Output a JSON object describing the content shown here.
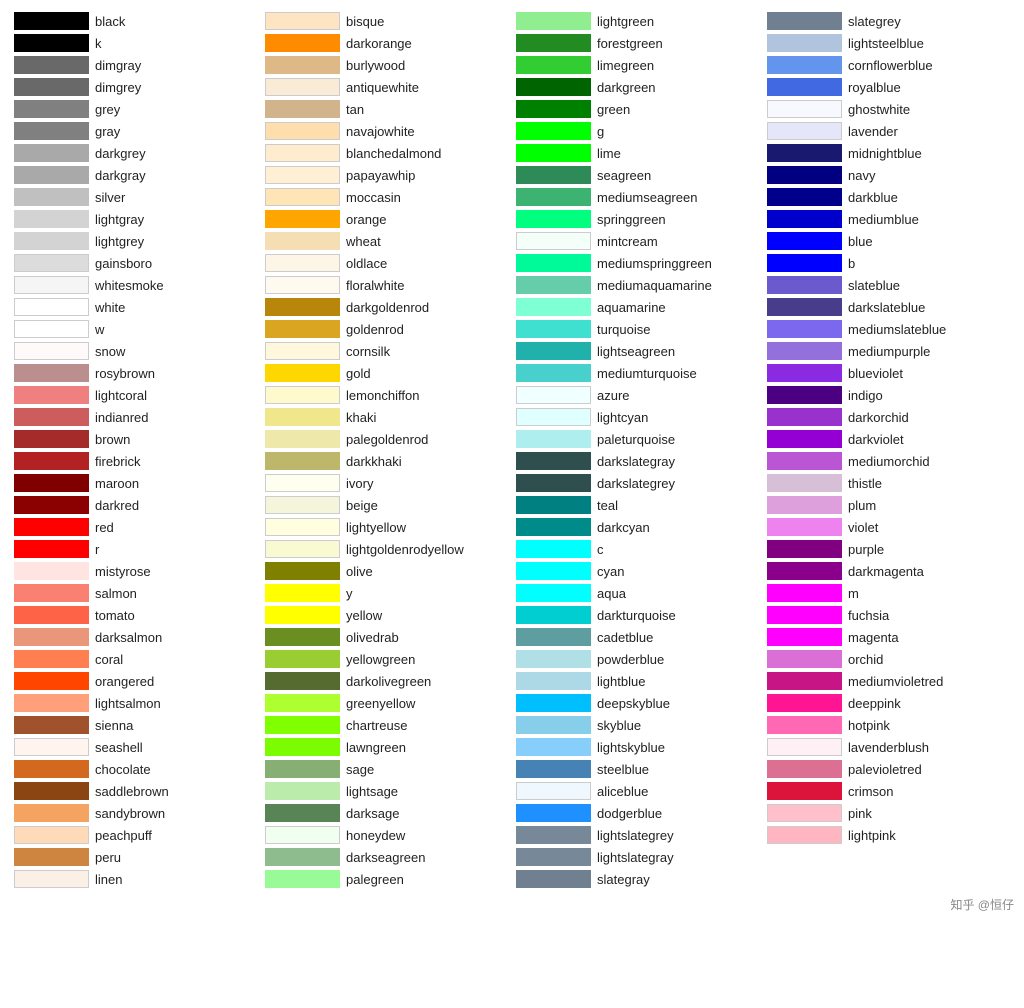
{
  "columns": [
    [
      {
        "name": "black",
        "color": "#000000"
      },
      {
        "name": "k",
        "color": "#000000"
      },
      {
        "name": "dimgray",
        "color": "#696969"
      },
      {
        "name": "dimgrey",
        "color": "#696969"
      },
      {
        "name": "grey",
        "color": "#808080"
      },
      {
        "name": "gray",
        "color": "#808080"
      },
      {
        "name": "darkgrey",
        "color": "#a9a9a9"
      },
      {
        "name": "darkgray",
        "color": "#a9a9a9"
      },
      {
        "name": "silver",
        "color": "#c0c0c0"
      },
      {
        "name": "lightgray",
        "color": "#d3d3d3"
      },
      {
        "name": "lightgrey",
        "color": "#d3d3d3"
      },
      {
        "name": "gainsboro",
        "color": "#dcdcdc"
      },
      {
        "name": "whitesmoke",
        "color": "#f5f5f5"
      },
      {
        "name": "white",
        "color": "#ffffff"
      },
      {
        "name": "w",
        "color": "#ffffff"
      },
      {
        "name": "snow",
        "color": "#fffafa"
      },
      {
        "name": "rosybrown",
        "color": "#bc8f8f"
      },
      {
        "name": "lightcoral",
        "color": "#f08080"
      },
      {
        "name": "indianred",
        "color": "#cd5c5c"
      },
      {
        "name": "brown",
        "color": "#a52a2a"
      },
      {
        "name": "firebrick",
        "color": "#b22222"
      },
      {
        "name": "maroon",
        "color": "#800000"
      },
      {
        "name": "darkred",
        "color": "#8b0000"
      },
      {
        "name": "red",
        "color": "#ff0000"
      },
      {
        "name": "r",
        "color": "#ff0000"
      },
      {
        "name": "mistyrose",
        "color": "#ffe4e1"
      },
      {
        "name": "salmon",
        "color": "#fa8072"
      },
      {
        "name": "tomato",
        "color": "#ff6347"
      },
      {
        "name": "darksalmon",
        "color": "#e9967a"
      },
      {
        "name": "coral",
        "color": "#ff7f50"
      },
      {
        "name": "orangered",
        "color": "#ff4500"
      },
      {
        "name": "lightsalmon",
        "color": "#ffa07a"
      },
      {
        "name": "sienna",
        "color": "#a0522d"
      },
      {
        "name": "seashell",
        "color": "#fff5ee"
      },
      {
        "name": "chocolate",
        "color": "#d2691e"
      },
      {
        "name": "saddlebrown",
        "color": "#8b4513"
      },
      {
        "name": "sandybrown",
        "color": "#f4a460"
      },
      {
        "name": "peachpuff",
        "color": "#ffdab9"
      },
      {
        "name": "peru",
        "color": "#cd853f"
      },
      {
        "name": "linen",
        "color": "#faf0e6"
      }
    ],
    [
      {
        "name": "bisque",
        "color": "#ffe4c4"
      },
      {
        "name": "darkorange",
        "color": "#ff8c00"
      },
      {
        "name": "burlywood",
        "color": "#deb887"
      },
      {
        "name": "antiquewhite",
        "color": "#faebd7"
      },
      {
        "name": "tan",
        "color": "#d2b48c"
      },
      {
        "name": "navajowhite",
        "color": "#ffdead"
      },
      {
        "name": "blanchedalmond",
        "color": "#ffebcd"
      },
      {
        "name": "papayawhip",
        "color": "#ffefd5"
      },
      {
        "name": "moccasin",
        "color": "#ffe4b5"
      },
      {
        "name": "orange",
        "color": "#ffa500"
      },
      {
        "name": "wheat",
        "color": "#f5deb3"
      },
      {
        "name": "oldlace",
        "color": "#fdf5e6"
      },
      {
        "name": "floralwhite",
        "color": "#fffaf0"
      },
      {
        "name": "darkgoldenrod",
        "color": "#b8860b"
      },
      {
        "name": "goldenrod",
        "color": "#daa520"
      },
      {
        "name": "cornsilk",
        "color": "#fff8dc"
      },
      {
        "name": "gold",
        "color": "#ffd700"
      },
      {
        "name": "lemonchiffon",
        "color": "#fffacd"
      },
      {
        "name": "khaki",
        "color": "#f0e68c"
      },
      {
        "name": "palegoldenrod",
        "color": "#eee8aa"
      },
      {
        "name": "darkkhaki",
        "color": "#bdb76b"
      },
      {
        "name": "ivory",
        "color": "#fffff0"
      },
      {
        "name": "beige",
        "color": "#f5f5dc"
      },
      {
        "name": "lightyellow",
        "color": "#ffffe0"
      },
      {
        "name": "lightgoldenrodyellow",
        "color": "#fafad2"
      },
      {
        "name": "olive",
        "color": "#808000"
      },
      {
        "name": "y",
        "color": "#ffff00"
      },
      {
        "name": "yellow",
        "color": "#ffff00"
      },
      {
        "name": "olivedrab",
        "color": "#6b8e23"
      },
      {
        "name": "yellowgreen",
        "color": "#9acd32"
      },
      {
        "name": "darkolivegreen",
        "color": "#556b2f"
      },
      {
        "name": "greenyellow",
        "color": "#adff2f"
      },
      {
        "name": "chartreuse",
        "color": "#7fff00"
      },
      {
        "name": "lawngreen",
        "color": "#7cfc00"
      },
      {
        "name": "sage",
        "color": "#87ae73"
      },
      {
        "name": "lightsage",
        "color": "#bcecac"
      },
      {
        "name": "darksage",
        "color": "#598556"
      },
      {
        "name": "honeydew",
        "color": "#f0fff0"
      },
      {
        "name": "darkseagreen",
        "color": "#8fbc8f"
      },
      {
        "name": "palegreen",
        "color": "#98fb98"
      }
    ],
    [
      {
        "name": "lightgreen",
        "color": "#90ee90"
      },
      {
        "name": "forestgreen",
        "color": "#228b22"
      },
      {
        "name": "limegreen",
        "color": "#32cd32"
      },
      {
        "name": "darkgreen",
        "color": "#006400"
      },
      {
        "name": "green",
        "color": "#008000"
      },
      {
        "name": "g",
        "color": "#00ff00"
      },
      {
        "name": "lime",
        "color": "#00ff00"
      },
      {
        "name": "seagreen",
        "color": "#2e8b57"
      },
      {
        "name": "mediumseagreen",
        "color": "#3cb371"
      },
      {
        "name": "springgreen",
        "color": "#00ff7f"
      },
      {
        "name": "mintcream",
        "color": "#f5fffa"
      },
      {
        "name": "mediumspringgreen",
        "color": "#00fa9a"
      },
      {
        "name": "mediumaquamarine",
        "color": "#66cdaa"
      },
      {
        "name": "aquamarine",
        "color": "#7fffd4"
      },
      {
        "name": "turquoise",
        "color": "#40e0d0"
      },
      {
        "name": "lightseagreen",
        "color": "#20b2aa"
      },
      {
        "name": "mediumturquoise",
        "color": "#48d1cc"
      },
      {
        "name": "azure",
        "color": "#f0ffff"
      },
      {
        "name": "lightcyan",
        "color": "#e0ffff"
      },
      {
        "name": "paleturquoise",
        "color": "#afeeee"
      },
      {
        "name": "darkslategray",
        "color": "#2f4f4f"
      },
      {
        "name": "darkslategrey",
        "color": "#2f4f4f"
      },
      {
        "name": "teal",
        "color": "#008080"
      },
      {
        "name": "darkcyan",
        "color": "#008b8b"
      },
      {
        "name": "c",
        "color": "#00ffff"
      },
      {
        "name": "cyan",
        "color": "#00ffff"
      },
      {
        "name": "aqua",
        "color": "#00ffff"
      },
      {
        "name": "darkturquoise",
        "color": "#00ced1"
      },
      {
        "name": "cadetblue",
        "color": "#5f9ea0"
      },
      {
        "name": "powderblue",
        "color": "#b0e0e6"
      },
      {
        "name": "lightblue",
        "color": "#add8e6"
      },
      {
        "name": "deepskyblue",
        "color": "#00bfff"
      },
      {
        "name": "skyblue",
        "color": "#87ceeb"
      },
      {
        "name": "lightskyblue",
        "color": "#87cefa"
      },
      {
        "name": "steelblue",
        "color": "#4682b4"
      },
      {
        "name": "aliceblue",
        "color": "#f0f8ff"
      },
      {
        "name": "dodgerblue",
        "color": "#1e90ff"
      },
      {
        "name": "lightslategrey",
        "color": "#778899"
      },
      {
        "name": "lightslategray",
        "color": "#778899"
      },
      {
        "name": "slategray",
        "color": "#708090"
      }
    ],
    [
      {
        "name": "slategrey",
        "color": "#708090"
      },
      {
        "name": "lightsteelblue",
        "color": "#b0c4de"
      },
      {
        "name": "cornflowerblue",
        "color": "#6495ed"
      },
      {
        "name": "royalblue",
        "color": "#4169e1"
      },
      {
        "name": "ghostwhite",
        "color": "#f8f8ff"
      },
      {
        "name": "lavender",
        "color": "#e6e6fa"
      },
      {
        "name": "midnightblue",
        "color": "#191970"
      },
      {
        "name": "navy",
        "color": "#000080"
      },
      {
        "name": "darkblue",
        "color": "#00008b"
      },
      {
        "name": "mediumblue",
        "color": "#0000cd"
      },
      {
        "name": "blue",
        "color": "#0000ff"
      },
      {
        "name": "b",
        "color": "#0000ff"
      },
      {
        "name": "slateblue",
        "color": "#6a5acd"
      },
      {
        "name": "darkslateblue",
        "color": "#483d8b"
      },
      {
        "name": "mediumslateblue",
        "color": "#7b68ee"
      },
      {
        "name": "mediumpurple",
        "color": "#9370db"
      },
      {
        "name": "blueviolet",
        "color": "#8a2be2"
      },
      {
        "name": "indigo",
        "color": "#4b0082"
      },
      {
        "name": "darkorchid",
        "color": "#9932cc"
      },
      {
        "name": "darkviolet",
        "color": "#9400d3"
      },
      {
        "name": "mediumorchid",
        "color": "#ba55d3"
      },
      {
        "name": "thistle",
        "color": "#d8bfd8"
      },
      {
        "name": "plum",
        "color": "#dda0dd"
      },
      {
        "name": "violet",
        "color": "#ee82ee"
      },
      {
        "name": "purple",
        "color": "#800080"
      },
      {
        "name": "darkmagenta",
        "color": "#8b008b"
      },
      {
        "name": "m",
        "color": "#ff00ff"
      },
      {
        "name": "fuchsia",
        "color": "#ff00ff"
      },
      {
        "name": "magenta",
        "color": "#ff00ff"
      },
      {
        "name": "orchid",
        "color": "#da70d6"
      },
      {
        "name": "mediumvioletred",
        "color": "#c71585"
      },
      {
        "name": "deeppink",
        "color": "#ff1493"
      },
      {
        "name": "hotpink",
        "color": "#ff69b4"
      },
      {
        "name": "lavenderblush",
        "color": "#fff0f5"
      },
      {
        "name": "palevioletred",
        "color": "#db7093"
      },
      {
        "name": "crimson",
        "color": "#dc143c"
      },
      {
        "name": "pink",
        "color": "#ffc0cb"
      },
      {
        "name": "lightpink",
        "color": "#ffb6c1"
      },
      {
        "name": "",
        "color": ""
      },
      {
        "name": "",
        "color": ""
      }
    ]
  ],
  "watermark": "知乎 @恒仔"
}
